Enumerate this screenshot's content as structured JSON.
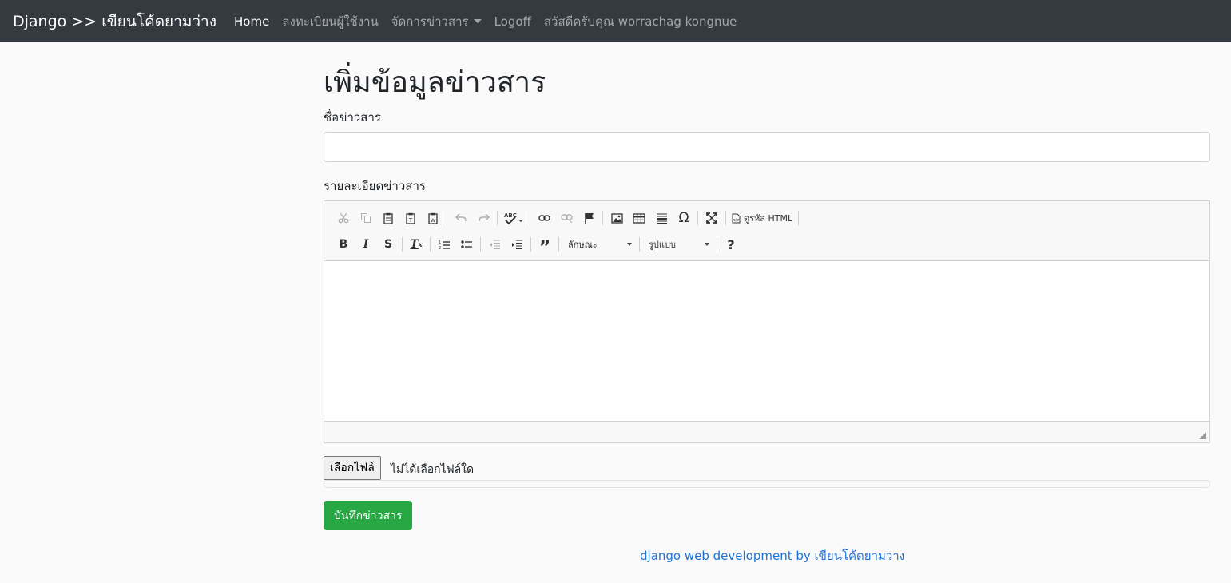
{
  "navbar": {
    "brand": "Django >> เขียนโค้ดยามว่าง",
    "items": [
      {
        "label": "Home",
        "active": true
      },
      {
        "label": "ลงทะเบียนผู้ใช้งาน",
        "active": false
      },
      {
        "label": "จัดการข่าวสาร",
        "active": false,
        "dropdown": true
      },
      {
        "label": "Logoff",
        "active": false
      },
      {
        "label": "สวัสดีครับคุณ worrachag kongnue",
        "active": false
      }
    ]
  },
  "form": {
    "title": "เพิ่มข้อมูลข่าวสาร",
    "name_label": "ชื่อข่าวสาร",
    "name_value": "",
    "detail_label": "รายละเอียดข่าวสาร",
    "editor": {
      "source_label": "ดูรหัส HTML",
      "style_combo": "ลักษณะ",
      "format_combo": "รูปแบบ",
      "icons_row1": [
        "cut-icon",
        "copy-icon",
        "paste-icon",
        "paste-text-icon",
        "paste-word-icon",
        "undo-icon",
        "redo-icon",
        "spellcheck-icon",
        "link-icon",
        "unlink-icon",
        "anchor-icon",
        "image-icon",
        "table-icon",
        "horizontal-line-icon",
        "special-char-icon",
        "maximize-icon",
        "source-icon"
      ],
      "icons_row2": [
        "bold-icon",
        "italic-icon",
        "strike-icon",
        "remove-format-icon",
        "numbered-list-icon",
        "bulleted-list-icon",
        "outdent-icon",
        "indent-icon",
        "blockquote-icon",
        "help-icon"
      ]
    },
    "file_button": "เลือกไฟล์",
    "file_status": "ไม่ได้เลือกไฟล์ใด",
    "submit_label": "บันทึกข่าวสาร"
  },
  "footer": {
    "text": "django web development by เขียนโค้ดยามว่าง"
  },
  "colors": {
    "navbar_bg": "#343a40",
    "success": "#28a745",
    "link": "#1e73d6"
  }
}
